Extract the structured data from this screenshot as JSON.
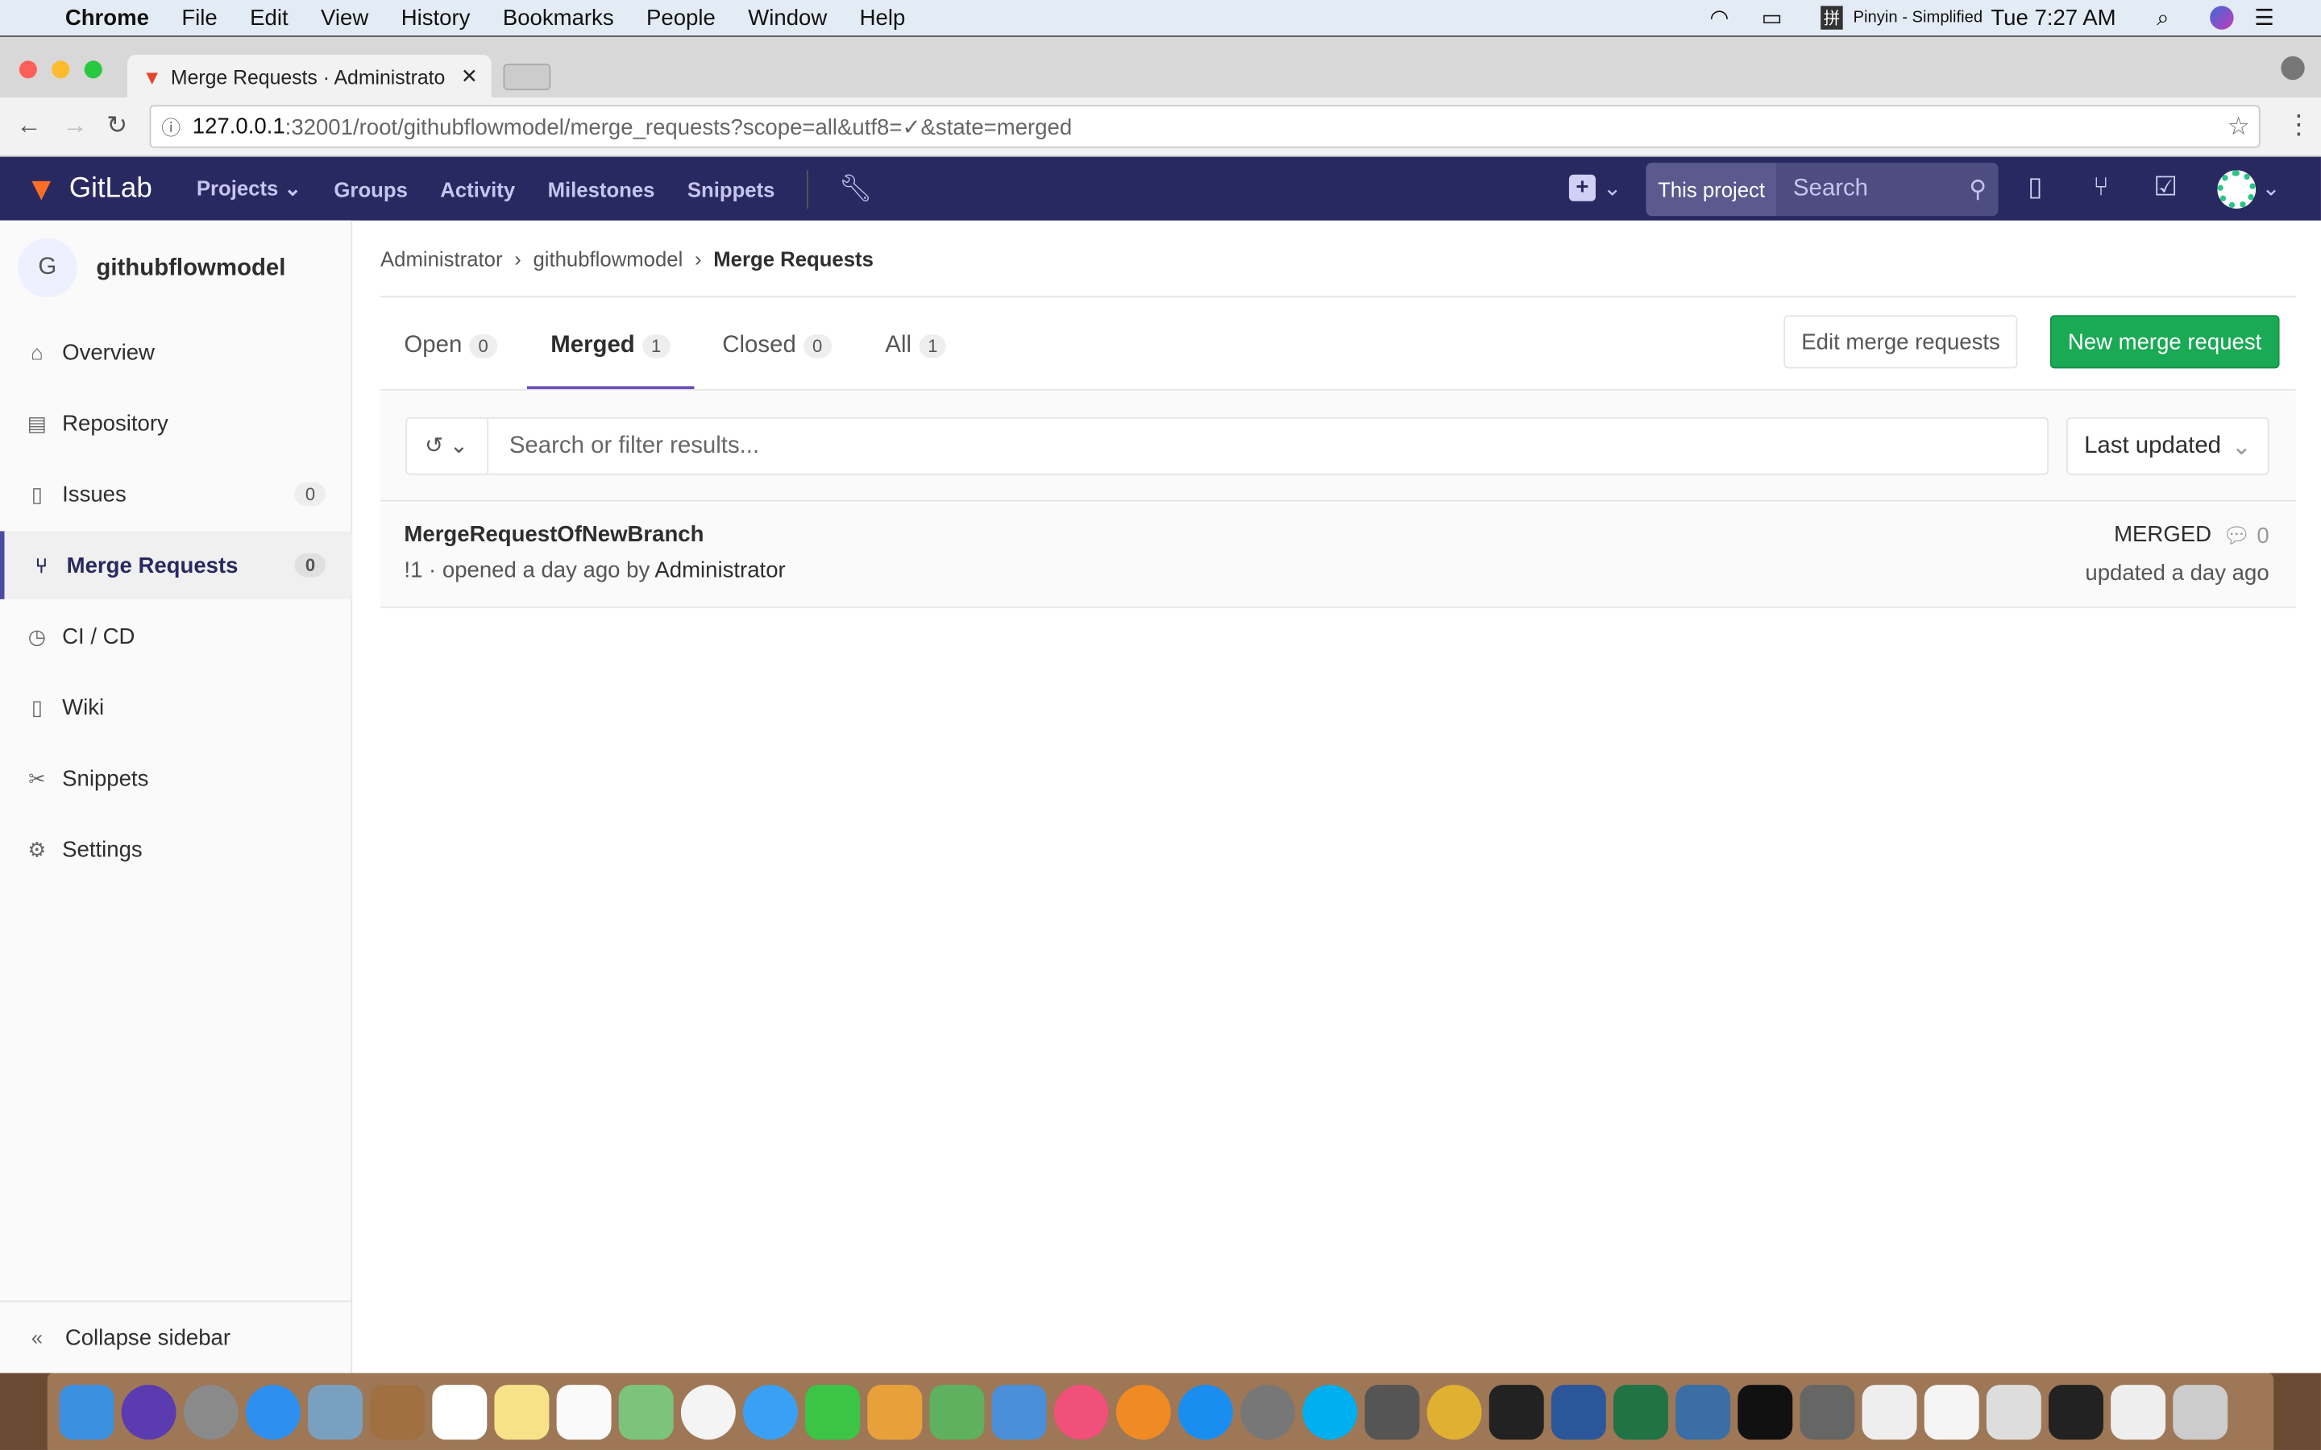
{
  "menubar": {
    "app": "Chrome",
    "items": [
      "File",
      "Edit",
      "View",
      "History",
      "Bookmarks",
      "People",
      "Window",
      "Help"
    ],
    "input_method": "Pinyin - Simplified",
    "clock": "Tue 7:27 AM"
  },
  "browser": {
    "tab_title": "Merge Requests · Administrato",
    "url_host": "127.0.0.1",
    "url_rest": ":32001/root/githubflowmodel/merge_requests?scope=all&utf8=✓&state=merged"
  },
  "nav": {
    "brand": "GitLab",
    "links": [
      "Projects",
      "Groups",
      "Activity",
      "Milestones",
      "Snippets"
    ],
    "scope": "This project",
    "search_placeholder": "Search"
  },
  "sidebar": {
    "avatar_letter": "G",
    "project": "githubflowmodel",
    "items": [
      {
        "label": "Overview",
        "icon": "home-icon"
      },
      {
        "label": "Repository",
        "icon": "doc-icon"
      },
      {
        "label": "Issues",
        "icon": "issues-icon",
        "count": "0"
      },
      {
        "label": "Merge Requests",
        "icon": "merge-request-icon",
        "count": "0",
        "active": true
      },
      {
        "label": "CI / CD",
        "icon": "pipeline-icon"
      },
      {
        "label": "Wiki",
        "icon": "book-icon"
      },
      {
        "label": "Snippets",
        "icon": "scissors-icon"
      },
      {
        "label": "Settings",
        "icon": "gear-icon"
      }
    ],
    "collapse": "Collapse sidebar"
  },
  "breadcrumb": [
    "Administrator",
    "githubflowmodel",
    "Merge Requests"
  ],
  "tabs": [
    {
      "label": "Open",
      "count": "0"
    },
    {
      "label": "Merged",
      "count": "1",
      "active": true
    },
    {
      "label": "Closed",
      "count": "0"
    },
    {
      "label": "All",
      "count": "1"
    }
  ],
  "buttons": {
    "edit": "Edit merge requests",
    "new": "New merge request"
  },
  "filter": {
    "placeholder": "Search or filter results...",
    "sort": "Last updated"
  },
  "merge_requests": [
    {
      "title": "MergeRequestOfNewBranch",
      "ref": "!1",
      "opened": " · opened a day ago by ",
      "author": "Administrator",
      "status": "MERGED",
      "comments": "0",
      "updated": "updated a day ago"
    }
  ],
  "colors": {
    "nav": "#292961",
    "accent": "#6b4fbb",
    "green": "#1aaa55"
  }
}
